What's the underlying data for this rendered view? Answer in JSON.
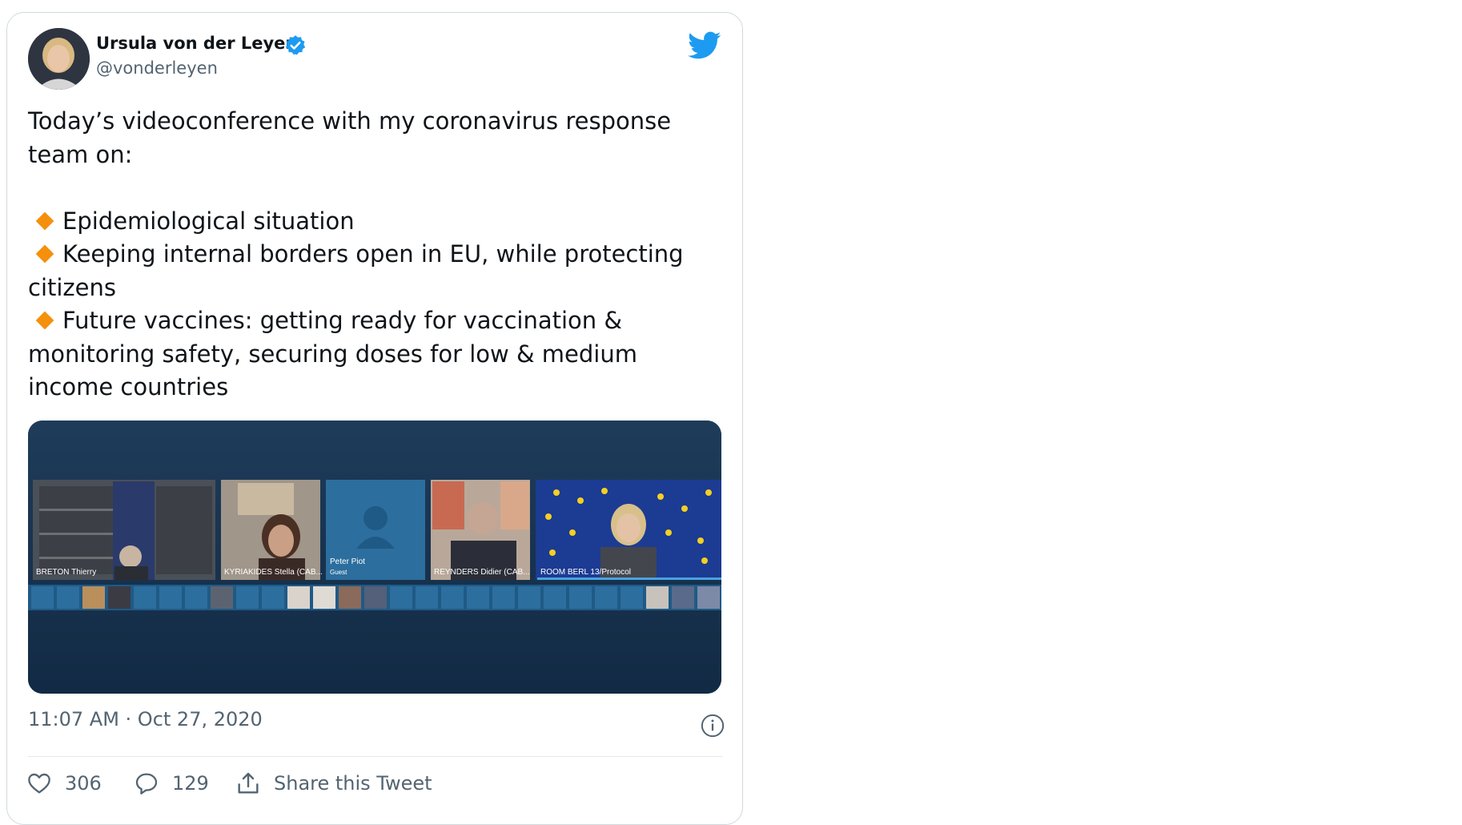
{
  "tweet": {
    "display_name": "Ursula von der Leyen",
    "handle": "@vonderleyen",
    "intro": "Today’s videoconference with my coronavirus response team on:",
    "bullets": [
      "Epidemiological situation",
      "Keeping internal borders open in EU, while protecting citizens",
      "Future vaccines: getting ready for vaccination & monitoring safety, securing doses for low & medium income countries"
    ],
    "timestamp": "11:07 AM · Oct 27, 2020"
  },
  "media": {
    "tiles": [
      {
        "name": "BRETON Thierry"
      },
      {
        "name": "KYRIAKIDES Stella (CAB..."
      },
      {
        "name": "Peter Piot",
        "role": "Guest"
      },
      {
        "name": "REYNDERS Didier (CAB..."
      },
      {
        "name": "ROOM BERL 13/Protocol"
      }
    ]
  },
  "actions": {
    "likes": "306",
    "replies": "129",
    "share_label": "Share this Tweet"
  },
  "colors": {
    "accent": "#1d9bf0",
    "bullet": "#f4900c",
    "muted": "#536471",
    "media_bg": "#17334f"
  },
  "icons": {
    "verified": "verified-badge-icon",
    "brand": "twitter-bird-icon",
    "bullet": "orange-diamond-icon",
    "info": "info-icon",
    "like": "heart-icon",
    "reply": "speech-bubble-icon",
    "share": "share-upload-icon"
  }
}
